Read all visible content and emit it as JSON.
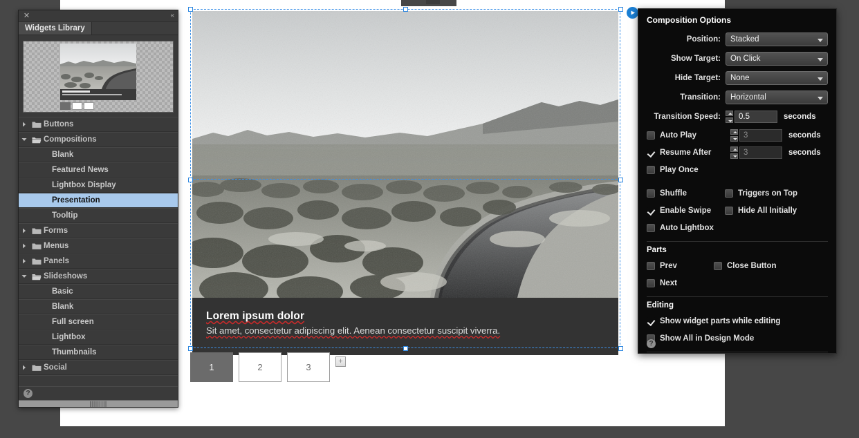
{
  "library_panel": {
    "close_icon": "close-icon",
    "collapse_icon": "collapse-icon",
    "tab_label": "Widgets Library",
    "help_label": "?",
    "preview": {
      "caption_title": "Lorem ipsum dolor",
      "caption_sub": "Sit amet, consectetur adipiscing elit. Aenean consectetur suscipit viverra.",
      "thumbs": [
        "1",
        "2",
        "3"
      ]
    },
    "tree": [
      {
        "label": "Buttons",
        "type": "folder",
        "expanded": false,
        "selected": false
      },
      {
        "label": "Compositions",
        "type": "folder",
        "expanded": true,
        "selected": false
      },
      {
        "label": "Blank",
        "type": "leaf",
        "selected": false
      },
      {
        "label": "Featured News",
        "type": "leaf",
        "selected": false
      },
      {
        "label": "Lightbox Display",
        "type": "leaf",
        "selected": false
      },
      {
        "label": "Presentation",
        "type": "leaf",
        "selected": true
      },
      {
        "label": "Tooltip",
        "type": "leaf",
        "selected": false
      },
      {
        "label": "Forms",
        "type": "folder",
        "expanded": false,
        "selected": false
      },
      {
        "label": "Menus",
        "type": "folder",
        "expanded": false,
        "selected": false
      },
      {
        "label": "Panels",
        "type": "folder",
        "expanded": false,
        "selected": false
      },
      {
        "label": "Slideshows",
        "type": "folder",
        "expanded": true,
        "selected": false
      },
      {
        "label": "Basic",
        "type": "leaf",
        "selected": false
      },
      {
        "label": "Blank",
        "type": "leaf",
        "selected": false
      },
      {
        "label": "Full screen",
        "type": "leaf",
        "selected": false
      },
      {
        "label": "Lightbox",
        "type": "leaf",
        "selected": false
      },
      {
        "label": "Thumbnails",
        "type": "leaf",
        "selected": false
      },
      {
        "label": "Social",
        "type": "folder",
        "expanded": false,
        "selected": false
      },
      {
        "label": "",
        "type": "empty",
        "selected": false
      },
      {
        "label": "",
        "type": "empty",
        "selected": false
      }
    ]
  },
  "stage": {
    "caption_title": "Lorem ipsum dolor",
    "caption_sub": "Sit amet, consectetur adipiscing elit. Aenean consectetur suscipit viverra.",
    "play_icon": "play-icon",
    "thumbnails": [
      "1",
      "2",
      "3"
    ],
    "active_thumbnail": "1",
    "add_label": "+",
    "spellcheck_color": "#cc2a2a",
    "selection_color": "#3d91e8"
  },
  "options_panel": {
    "title": "Composition Options",
    "fields": [
      {
        "label": "Position:",
        "value": "Stacked"
      },
      {
        "label": "Show Target:",
        "value": "On Click"
      },
      {
        "label": "Hide Target:",
        "value": "None"
      },
      {
        "label": "Transition:",
        "value": "Horizontal"
      }
    ],
    "transition_speed": {
      "label": "Transition Speed:",
      "value": "0.5",
      "unit": "seconds",
      "enabled": true
    },
    "auto_play": {
      "label": "Auto Play",
      "checked": false,
      "value": "3",
      "unit": "seconds",
      "enabled": false
    },
    "resume_after": {
      "label": "Resume After",
      "checked": true,
      "value": "3",
      "unit": "seconds",
      "enabled": false
    },
    "play_once": {
      "label": "Play Once",
      "checked": false
    },
    "toggles": [
      {
        "label": "Shuffle",
        "checked": false
      },
      {
        "label": "Triggers on Top",
        "checked": false
      },
      {
        "label": "Enable Swipe",
        "checked": true
      },
      {
        "label": "Hide All Initially",
        "checked": false
      },
      {
        "label": "Auto Lightbox",
        "checked": false
      }
    ],
    "parts_section": "Parts",
    "parts": [
      {
        "label": "Prev",
        "checked": false
      },
      {
        "label": "Close Button",
        "checked": false
      },
      {
        "label": "Next",
        "checked": false
      }
    ],
    "editing_section": "Editing",
    "editing": [
      {
        "label": "Show widget parts while editing",
        "checked": true
      },
      {
        "label": "Show All in Design Mode",
        "checked": false
      }
    ],
    "help_label": "?"
  }
}
